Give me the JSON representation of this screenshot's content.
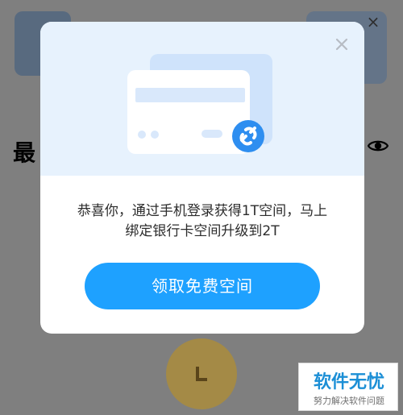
{
  "background": {
    "heading_partial": "最",
    "close_glyph": "×"
  },
  "modal": {
    "message_line1": "恭喜你，通过手机登录获得1T空间，马上",
    "message_line2": "绑定银行卡空间升级到2T",
    "button_label": "领取免费空间",
    "close_glyph": "×",
    "icons": {
      "close": "close-icon",
      "card": "bank-card-icon",
      "link": "link-icon",
      "eye": "eye-icon"
    }
  },
  "watermark": {
    "title": "软件无忧",
    "subtitle": "努力解决软件问题"
  },
  "colors": {
    "overlay": "#7f7f7f",
    "hero_bg": "#e7f2fd",
    "card_back": "#cfe3fb",
    "card_front": "#ffffff",
    "card_stripe": "#d9e8fb",
    "link_badge": "#2e8ef0",
    "button": "#1ea1ff",
    "button_text": "#ffffff",
    "text": "#2c2c2c",
    "watermark_primary": "#1c8fd6"
  }
}
